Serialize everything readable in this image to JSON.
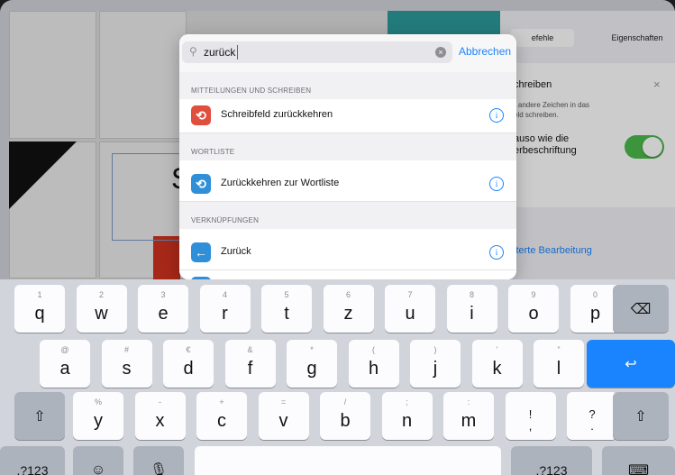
{
  "search": {
    "value": "zurück",
    "cancel_label": "Abbrechen"
  },
  "sections": [
    {
      "title": "MITTEILUNGEN UND SCHREIBEN",
      "items": [
        {
          "label": "Schreibfeld zurückkehren",
          "icon": "undo-icon",
          "color": "#e04e3d"
        }
      ]
    },
    {
      "title": "WORTLISTE",
      "items": [
        {
          "label": "Zurückkehren zur Wortliste",
          "icon": "undo-icon",
          "color": "#2f8fd8"
        }
      ]
    },
    {
      "title": "VERKNÜPFUNGEN",
      "items": [
        {
          "label": "Zurück",
          "icon": "arrow-left-icon",
          "color": "#2f8fd8"
        }
      ]
    }
  ],
  "background_panel": {
    "tab_left": "efehle",
    "tab_right": "Eigenschaften",
    "header": "chreiben",
    "hint_line1": "r andere Zeichen in das",
    "hint_line2": "eld schreiben.",
    "toggle_line1": "auso wie die",
    "toggle_line2": "erbeschriftung",
    "link": "iterte Bearbeitung",
    "canvas_letter": "S"
  },
  "keyboard": {
    "row1": [
      {
        "k": "q",
        "s": "1"
      },
      {
        "k": "w",
        "s": "2"
      },
      {
        "k": "e",
        "s": "3"
      },
      {
        "k": "r",
        "s": "4"
      },
      {
        "k": "t",
        "s": "5"
      },
      {
        "k": "z",
        "s": "6"
      },
      {
        "k": "u",
        "s": "7"
      },
      {
        "k": "i",
        "s": "8"
      },
      {
        "k": "o",
        "s": "9"
      },
      {
        "k": "p",
        "s": "0"
      }
    ],
    "row2": [
      {
        "k": "a",
        "s": "@"
      },
      {
        "k": "s",
        "s": "#"
      },
      {
        "k": "d",
        "s": "€"
      },
      {
        "k": "f",
        "s": "&"
      },
      {
        "k": "g",
        "s": "*"
      },
      {
        "k": "h",
        "s": "("
      },
      {
        "k": "j",
        "s": ")"
      },
      {
        "k": "k",
        "s": "’"
      },
      {
        "k": "l",
        "s": "”"
      }
    ],
    "row3": [
      {
        "k": "y",
        "s": "%"
      },
      {
        "k": "x",
        "s": "-"
      },
      {
        "k": "c",
        "s": "+"
      },
      {
        "k": "v",
        "s": "="
      },
      {
        "k": "b",
        "s": "/"
      },
      {
        "k": "n",
        "s": ";"
      },
      {
        "k": "m",
        "s": ":"
      },
      {
        "k": "!\n,",
        "s": ""
      },
      {
        "k": "?\n.",
        "s": ""
      }
    ],
    "numbers_label": ".?123",
    "numbers_label_right": ".?123"
  }
}
